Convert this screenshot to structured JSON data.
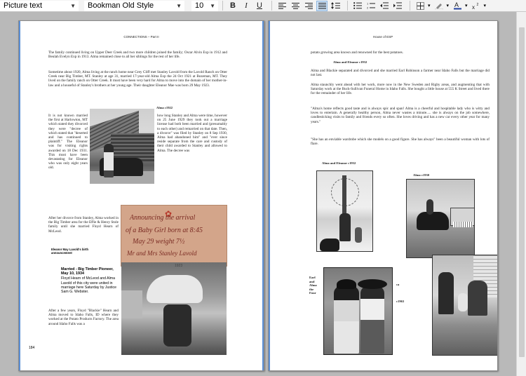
{
  "toolbar": {
    "paragraph_style": "Picture text",
    "font_family": "Bookman Old Style",
    "font_size": "10",
    "bold_label": "B",
    "italic_label": "I",
    "underline_label": "U",
    "active_alignment": "justify",
    "color_accent": "#cfe3f7"
  },
  "left_page": {
    "header": "CONNECTIONS – Part II",
    "para1": "The family continued living on Upper Deer Creek and two more children joined the family; Oscar Alvin Exp in 1912 and Beulah Evelyn Exp in 1913. Alma remained close to all her siblings for the rest of her life.",
    "para2": "Sometime about 1920, Alma living at the ranch home near Grey Cliff met Stanley Lavold from the Lavold Ranch on Otter Creek near Big Timber, MT. Stanley at age 31, married 17-year-old Alma Exp the 24 Oct 1921 at Bozeman, MT. They lived on the family ranch on Otter Creek. It must have been very hard for Alma to move into the domain of her mother-in-law and a houseful of Stanley's brothers at her young age. Their daughter Eleanor Mae was born 29 May 1923.",
    "photo_caption_alma": "Alma c1922",
    "col_left": "It is not known married the first at Harlowton, MT which stated they divorced they were \"decree of which stated that \"deserted and has continued to plaintiff.\" The Eleanor was for visiting rights awarded on 18 Dec 1931. This must have been devastating for Eleanor who was only eight years old.",
    "col_right": "how long Stanley and Alma were time, however on 25 June 1929 they took out a marriage license had both been married and (presumably to each other) and remarried on that date. Then, a divorce\" was filed by Stanley on 8 Sep 1930, Alma had abandoned him\" and \"ever since reside separate from the care and custody of their child awarded to Stanley and allowed to Alma. The decree was",
    "para_after": "After her divorce from Stanley, Alma worked in the Big Timber area for the Effie & Henry Stole family until she married Floyd Hearn of McLeod.",
    "caption_small": "Eleanor May Lavold's birth announcement",
    "note_line1": "Announcing the arrival",
    "note_line2": "of a Baby Girl born at 8:45",
    "note_line3": "May 29    weight 7½",
    "note_line4": "Mr and Mrs Stanley Lavold",
    "photo_year": "1923",
    "clip_title": "Married - Big Timber Pioneer, May 10, 1934",
    "clip_body": "Floyd Hearn of McLeod and Alma Lavold of this city were united in marriage here Saturday by Justice Sam G. Webster.",
    "para_last": "After a few years, Floyd \"Blackie\" Hearn and Alma moved to Idaho Falls, ID where they worked at the Potato Products Factory. The area around Idaho Falls was a",
    "page_number": "184"
  },
  "right_page": {
    "header": "House of ESP",
    "line1": "potato growing area known and renowned for the best potatoes.",
    "photo_caption_1": "Alma and Eleanor c1932",
    "para1": "Alma and Blackie separated and divorced and she married Earl Robinson a farmer near Idaho Falls but the marriage did not last.",
    "para2": "Alma staunchly went ahead with her work, more now in the New Sweden and Rigby areas, and augmenting that with Saturday work at the Buck-Sullivan Funeral Home in Idaho Falls. She bought a little house at 555 K Street and lived there for the remainder of her life.",
    "para3": "\"Alma's home reflects good taste and is always spic and span! Alma is a cheerful and hospitable lady who is witty and loves to entertain. A generally healthy person, Alma never wastes a minute..... she is always on the job somewhere, candlesticking visits to family and friends every so often. She loves driving and has a new car every other year for many years.\"",
    "para4": "\"She has an enviable wardrobe which she models on a good figure. She has always\" been a beautiful woman with lots of flare.",
    "photo_caption_2": "Alma and Eleanor c1932",
    "photo_caption_3": "Alma c1930",
    "side_label_1": "Earl and Alma the Four",
    "side_label_2": "ca",
    "side_label_3": "c1963"
  }
}
